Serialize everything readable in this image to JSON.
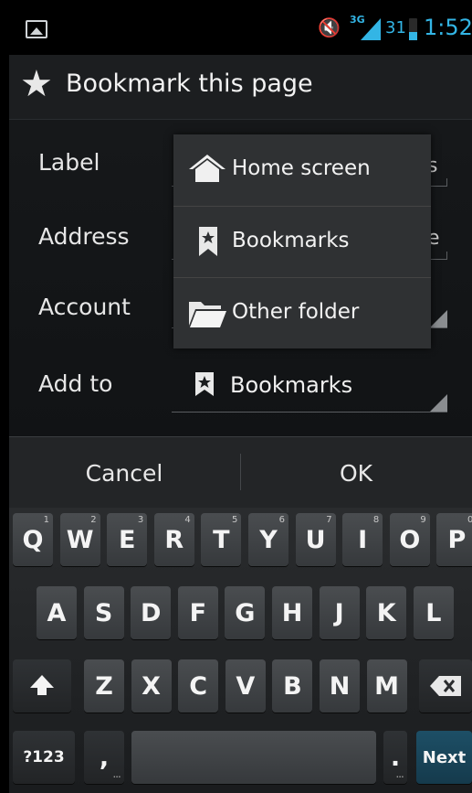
{
  "status_bar": {
    "network": "3G",
    "battery_percent": "31",
    "time": "1:52",
    "icons": [
      "image-icon",
      "mute-icon",
      "signal-icon",
      "battery-icon"
    ]
  },
  "dialog": {
    "title": "Bookmark this page",
    "rows": {
      "label": "Label",
      "address": "Address",
      "account": "Account",
      "add_to": "Add to"
    },
    "add_to_value": "Bookmarks",
    "label_field_tail": "s",
    "address_field_tail": "e"
  },
  "dropdown": {
    "items": [
      {
        "label": "Home screen",
        "icon": "home-icon"
      },
      {
        "label": "Bookmarks",
        "icon": "bookmark-icon"
      },
      {
        "label": "Other folder",
        "icon": "folder-icon"
      }
    ]
  },
  "buttons": {
    "cancel": "Cancel",
    "ok": "OK"
  },
  "keyboard": {
    "row1": [
      {
        "k": "Q",
        "h": "1"
      },
      {
        "k": "W",
        "h": "2"
      },
      {
        "k": "E",
        "h": "3"
      },
      {
        "k": "R",
        "h": "4"
      },
      {
        "k": "T",
        "h": "5"
      },
      {
        "k": "Y",
        "h": "6"
      },
      {
        "k": "U",
        "h": "7"
      },
      {
        "k": "I",
        "h": "8"
      },
      {
        "k": "O",
        "h": "9"
      },
      {
        "k": "P",
        "h": "0"
      }
    ],
    "row2": [
      "A",
      "S",
      "D",
      "F",
      "G",
      "H",
      "J",
      "K",
      "L"
    ],
    "row3": [
      "Z",
      "X",
      "C",
      "V",
      "B",
      "N",
      "M"
    ],
    "symbols": "?123",
    "comma": ",",
    "period": ".",
    "next": "Next"
  },
  "colors": {
    "accent": "#33b5e5"
  }
}
